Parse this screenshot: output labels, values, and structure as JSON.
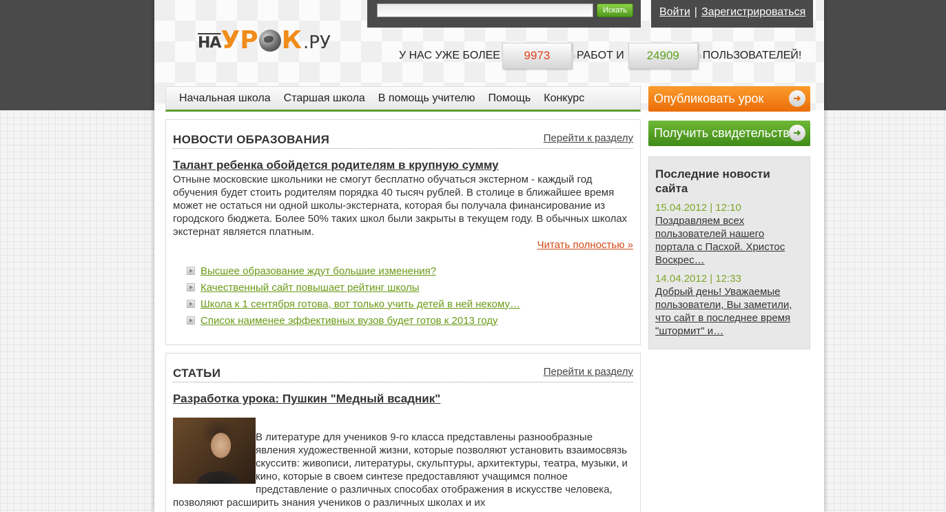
{
  "header": {
    "logo": {
      "na": "НА",
      "urok": "УР",
      "urok2": "К",
      "ru": ".РУ"
    },
    "search": {
      "placeholder": "",
      "button": "Искать"
    },
    "auth": {
      "login": "Войти",
      "separator": "|",
      "register": "Зарегистрироваться"
    },
    "stats": {
      "prefix": "У НАС УЖЕ БОЛЕЕ",
      "works": "9973",
      "middle": "РАБОТ И",
      "users": "24909",
      "suffix": "ПОЛЬЗОВАТЕЛЕЙ!"
    }
  },
  "nav": [
    "Начальная школа",
    "Старшая школа",
    "В помощь учителю",
    "Помощь",
    "Конкурс"
  ],
  "actions": {
    "publish": "Опубликовать урок",
    "certificate": "Получить свидетельство"
  },
  "site_news": {
    "title": "Последние новости сайта",
    "items": [
      {
        "date": "15.04.2012 | 12:10",
        "text": "Поздравляем всех пользователей нашего портала с Пасхой. Христос Воскрес…"
      },
      {
        "date": "14.04.2012 | 12:33",
        "text": "Добрый день! Уважаемые пользователи, Вы заметили, что сайт в последнее время \"штормит\" и…"
      }
    ]
  },
  "news": {
    "title": "НОВОСТИ ОБРАЗОВАНИЯ",
    "section_link": "Перейти к разделу",
    "headline": "Талант ребенка обойдется родителям в крупную сумму",
    "lead": "Отныне московские школьники не смогут бесплатно обучаться экстерном - каждый год обучения будет стоить родителям порядка 40 тысяч рублей. В столице в ближайшее время может не остаться ни одной школы-экстерната, которая бы получала финансирование из городского бюджета. Более 50% таких школ были закрыты в текущем году. В обычных школах экстернат является платным.",
    "read_more": "Читать полностью »",
    "items": [
      "Высшее образование ждут большие изменения?",
      "Качественный сайт повышает рейтинг школы",
      "Школа к 1 сентября готова, вот только учить детей в ней некому…",
      "Список наименее эффективных вузов будет готов к 2013 году"
    ]
  },
  "articles": {
    "title": "СТАТЬИ",
    "section_link": "Перейти к разделу",
    "headline": "Разработка урока: Пушкин \"Медный всадник\"",
    "text": "В литературе для учеников 9-го класса представлены разнообразные явления художественной жизни, которые позволяют установить взаимосвязь скусситв: живописи, литературы, скульптуры, архитектуры, театра, музыки, и кино, которые в своем синтезе предоставляют учащимся полное представление о различных способах отображения в искусстве человека, позволяют расширить знания учеников о различных школах и их"
  },
  "colors": {
    "accent_green": "#5c9a2a",
    "accent_orange": "#ea6d08",
    "date_green": "#7fa52a",
    "readmore": "#d24a18"
  }
}
